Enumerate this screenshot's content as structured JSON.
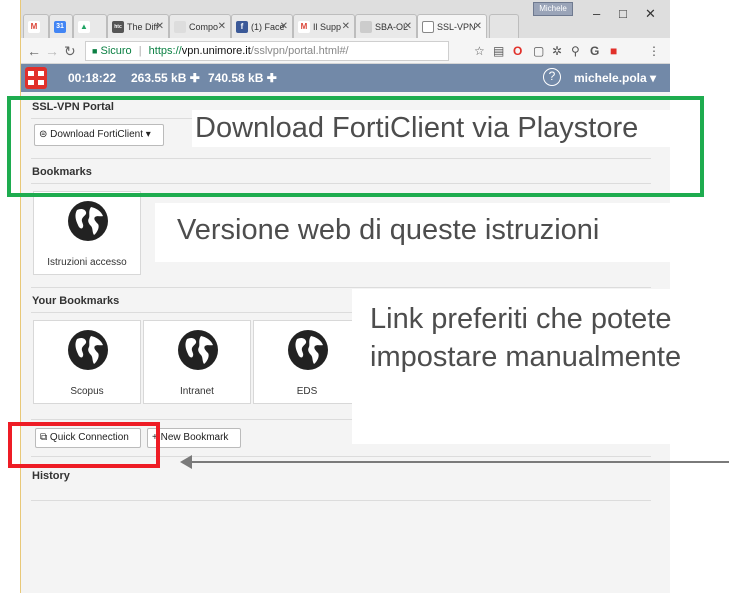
{
  "browser": {
    "tabs": [
      {
        "label": "",
        "icon": "gmail-icon",
        "icon_char": "M",
        "color": "#db4437"
      },
      {
        "label": "",
        "icon": "calendar-icon",
        "icon_char": "31",
        "color": "#4285f4"
      },
      {
        "label": "",
        "icon": "drive-icon",
        "icon_char": "▲",
        "color": "#1fa463"
      },
      {
        "label": "The Diff",
        "icon": "htc-icon",
        "icon_char": "htc",
        "color": "#555555"
      },
      {
        "label": "Compo",
        "icon": "compose-icon",
        "icon_char": "",
        "color": "#cccccc"
      },
      {
        "label": "(1) Face",
        "icon": "facebook-icon",
        "icon_char": "f",
        "color": "#3b5998"
      },
      {
        "label": "Il Supp",
        "icon": "gmail-icon",
        "icon_char": "M",
        "color": "#db4437"
      },
      {
        "label": "SBA-OL",
        "icon": "page-icon",
        "icon_char": "",
        "color": "#bbbbbb"
      },
      {
        "label": "SSL-VPN",
        "icon": "page-icon",
        "icon_char": "",
        "color": "#ffffff"
      }
    ],
    "user_badge": "Michele",
    "url": {
      "secure_label": "Sicuro",
      "separator": "|",
      "protocol": "https://",
      "host": "vpn.unimore.it",
      "path": "/sslvpn/portal.html#/"
    }
  },
  "topbar": {
    "session_time": "00:18:22",
    "bytes_sent": "263.55 kB ✚",
    "bytes_received": "740.58 kB ✚",
    "help": "?",
    "user": "michele.pola ▾"
  },
  "portal": {
    "ssl_title": "SSL-VPN Portal",
    "download_button": "Download FortiClient",
    "bookmarks_title": "Bookmarks",
    "bookmarks": [
      {
        "label": "Istruzioni accesso"
      }
    ],
    "your_bookmarks_title": "Your Bookmarks",
    "your_bookmarks": [
      {
        "label": "Scopus"
      },
      {
        "label": "Intranet"
      },
      {
        "label": "EDS"
      }
    ],
    "quick_connection": "Quick Connection",
    "new_bookmark": "New Bookmark",
    "history_title": "History"
  },
  "annotations": {
    "green_box_text": "Download FortiClient via Playstore",
    "web_text": "Versione web di queste istruzioni",
    "links_text": "Link preferiti che potete impostare manualmente",
    "green_color": "#1eac4f",
    "red_color": "#ee1c25"
  }
}
